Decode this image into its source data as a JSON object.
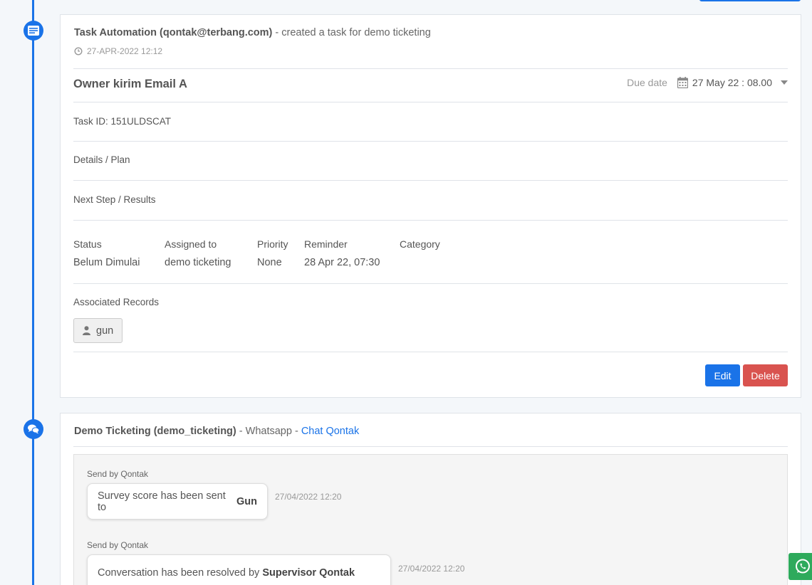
{
  "task_event": {
    "actor": "Task Automation (qontak@terbang.com)",
    "action": " - created a task for demo ticketing",
    "timestamp": "27-APR-2022 12:12",
    "task_title": "Owner kirim Email A",
    "due_label": "Due date",
    "due_value": "27 May 22 : 08.00",
    "task_id": "Task ID: 151ULDSCAT",
    "details_label": "Details / Plan",
    "next_step_label": "Next Step / Results",
    "meta": [
      {
        "key": "Status",
        "value": "Belum Dimulai"
      },
      {
        "key": "Assigned to",
        "value": "demo ticketing"
      },
      {
        "key": "Priority",
        "value": "None"
      },
      {
        "key": "Reminder",
        "value": "28 Apr 22, 07:30"
      },
      {
        "key": "Category",
        "value": ""
      }
    ],
    "associated_label": "Associated Records",
    "associated_chip": "gun",
    "edit_label": "Edit",
    "delete_label": "Delete"
  },
  "chat_event": {
    "actor": "Demo Ticketing (demo_ticketing)",
    "channel": " - Whatsapp - ",
    "link": "Chat Qontak",
    "messages": [
      {
        "sender": "Send by Qontak",
        "text": "Survey score has been sent to",
        "bold": "Gun",
        "time": "27/04/2022 12:20"
      },
      {
        "sender": "Send by Qontak",
        "text": "Conversation has been resolved by",
        "bold": "Supervisor Qontak",
        "time": "27/04/2022 12:20"
      }
    ]
  },
  "colors": {
    "accent": "#1a73e8",
    "danger": "#d9534f",
    "whatsapp": "#2eaa5c"
  }
}
